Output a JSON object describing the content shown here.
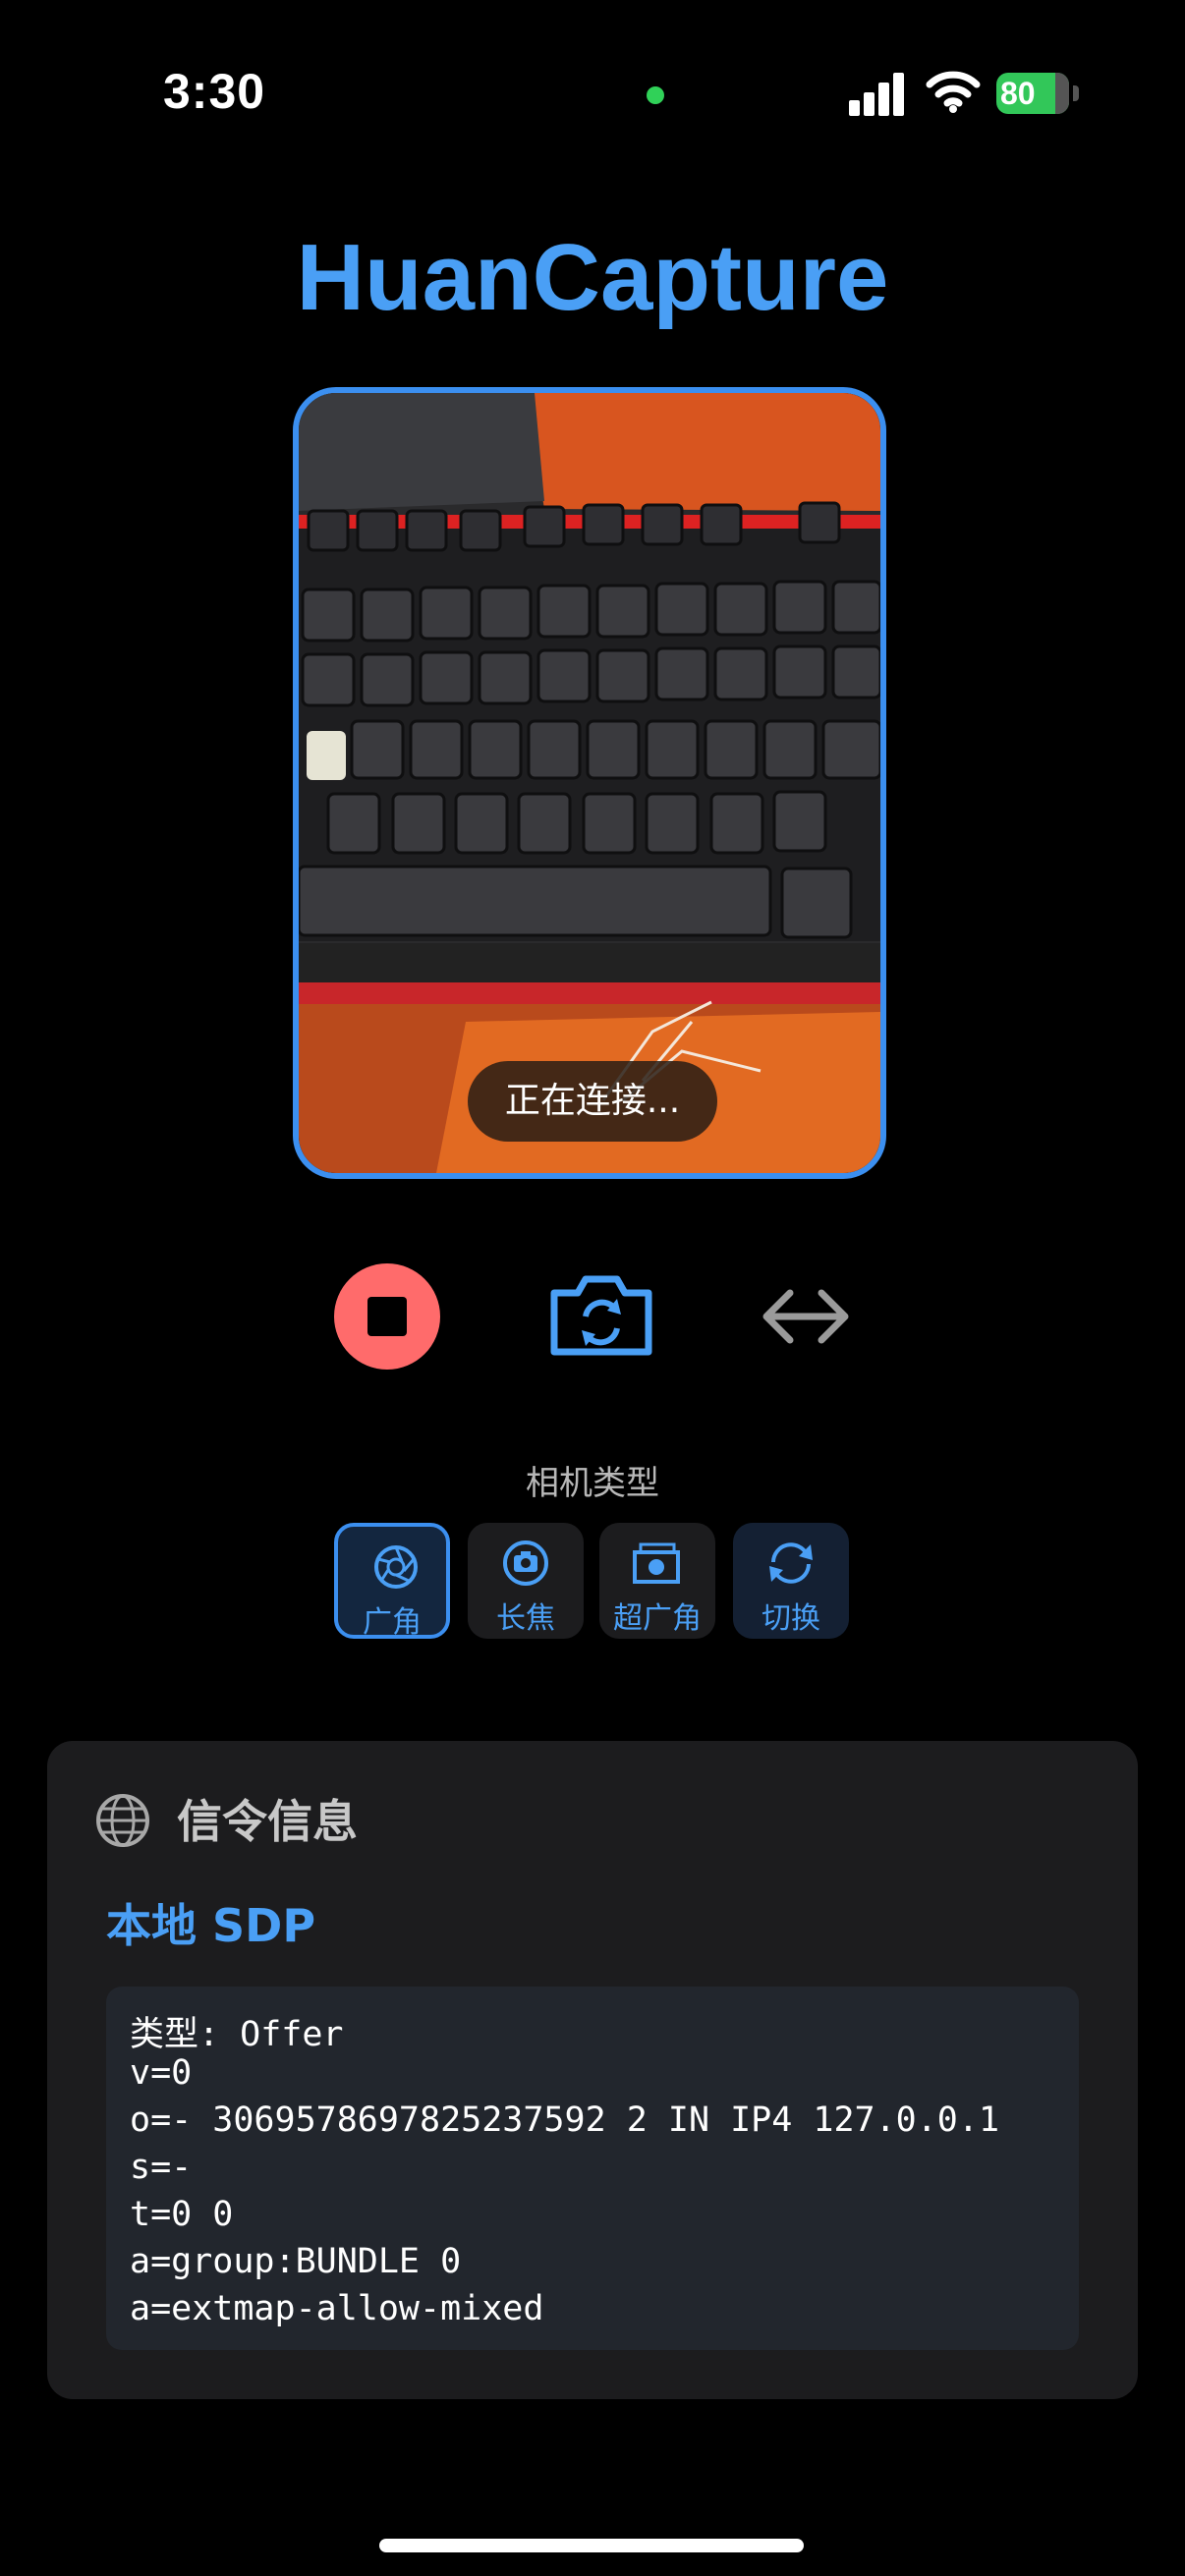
{
  "status_bar": {
    "time": "3:30",
    "battery": "80"
  },
  "app_title": "HuanCapture",
  "preview": {
    "status_text": "正在连接..."
  },
  "controls": {
    "stop": "stop-button",
    "flip": "camera-flip-icon",
    "mirror": "mirror-arrows-icon"
  },
  "camera_type": {
    "label": "相机类型",
    "options": [
      {
        "label": "广角",
        "icon": "aperture-icon",
        "active": true
      },
      {
        "label": "长焦",
        "icon": "camera-icon",
        "active": false
      },
      {
        "label": "超广角",
        "icon": "wide-camera-icon",
        "active": false
      },
      {
        "label": "切换",
        "icon": "switch-icon",
        "active": false
      }
    ]
  },
  "signaling": {
    "title": "信令信息",
    "section": "本地 SDP",
    "sdp_lines": [
      "类型: Offer",
      "v=0",
      "o=- 3069578697825237592 2 IN IP4 127.0.0.1",
      "s=-",
      "t=0 0",
      "a=group:BUNDLE 0",
      "a=extmap-allow-mixed"
    ]
  },
  "colors": {
    "accent": "#4a9ff5",
    "stop": "#ff6b6b",
    "card": "#1c1c1e"
  }
}
